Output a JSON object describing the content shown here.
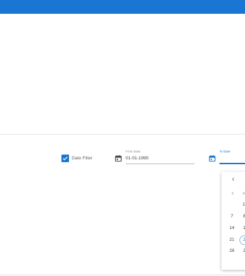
{
  "filter": {
    "checkbox_checked": true,
    "label": "Date Filter"
  },
  "from_date": {
    "label": "From Date",
    "value": "01-01-1990"
  },
  "to_date": {
    "label": "To Date",
    "value": ""
  },
  "calendar": {
    "prev_icon": "‹",
    "dow_labels": [
      "S",
      "M"
    ],
    "days": [
      "1",
      "7",
      "8",
      "14",
      "1",
      "21",
      "2",
      "28",
      "2"
    ]
  },
  "colors": {
    "accent": "#1976d2"
  }
}
